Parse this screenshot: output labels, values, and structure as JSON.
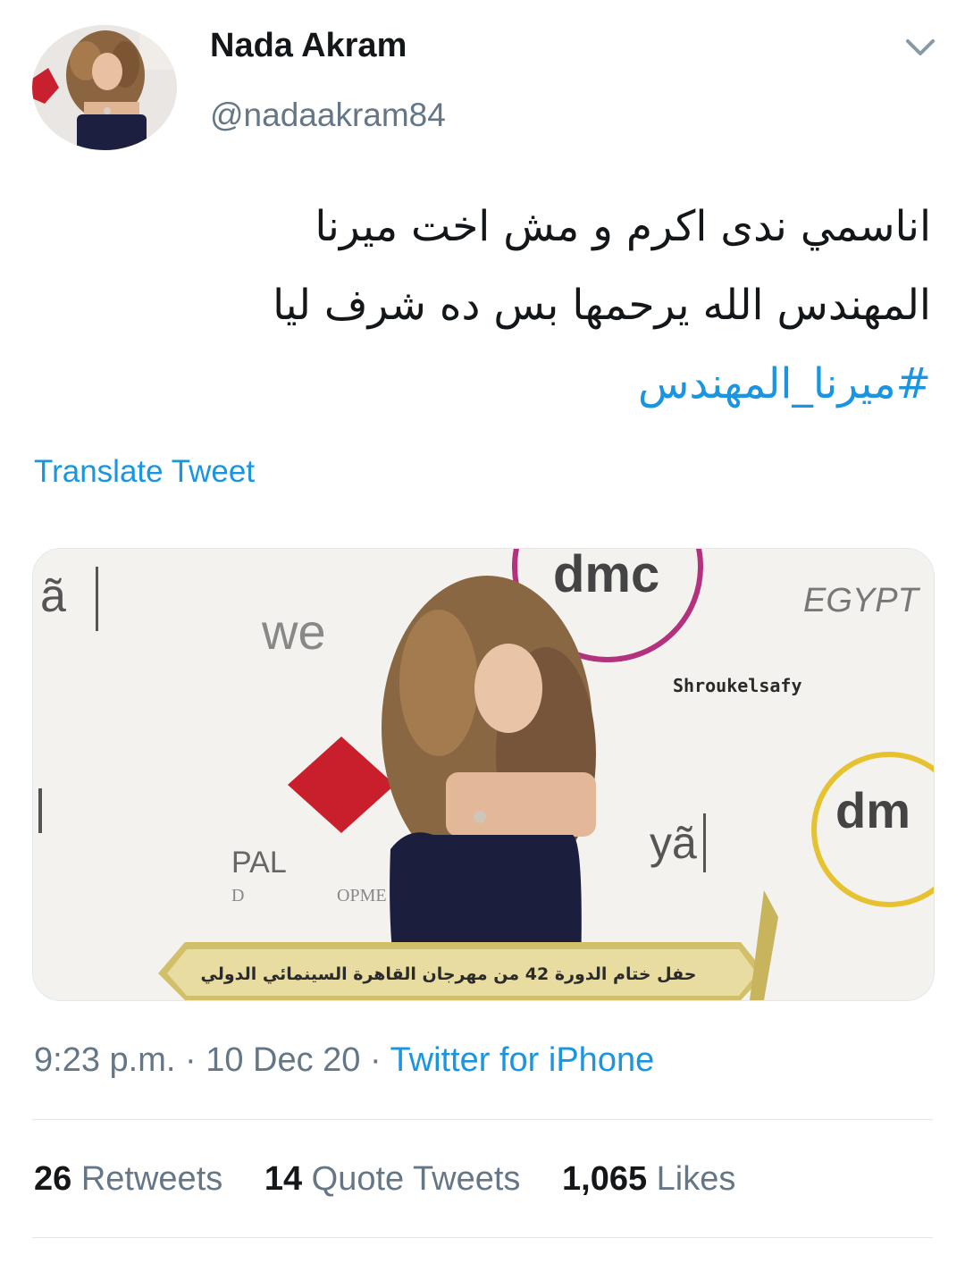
{
  "author": {
    "name": "Nada Akram",
    "handle": "@nadaakram84"
  },
  "tweet": {
    "lines": [
      "اناسمي ندى اكرم و مش اخت ميرنا",
      "المهندس الله يرحمها بس ده شرف ليا"
    ],
    "hashtag": "#ميرنا_المهندس",
    "translate_label": "Translate Tweet"
  },
  "media": {
    "logos": {
      "dmc_top": "dmc",
      "we": "we",
      "egypt": "EGYPT",
      "dm_right": "dm",
      "ya_left": "ã",
      "ya_center": "yã",
      "pal": "PAL",
      "dev": "D",
      "opm": "OPME"
    },
    "watermark": "Shroukelsafy",
    "banner_caption": "حفل ختام الدورة 42 من مهرجان القاهرة السينمائي الدولي"
  },
  "meta": {
    "time": "9:23 p.m.",
    "date": "10 Dec 20",
    "source": "Twitter for iPhone"
  },
  "stats": {
    "retweets_count": "26",
    "retweets_label": "Retweets",
    "quotes_count": "14",
    "quotes_label": "Quote Tweets",
    "likes_count": "1,065",
    "likes_label": "Likes"
  },
  "colors": {
    "link": "#1b95e0",
    "secondary_text": "#657786",
    "primary_text": "#14171a",
    "divider": "#e1e8ed"
  },
  "icons": {
    "caret": "chevron-down-icon",
    "avatar": "avatar"
  }
}
